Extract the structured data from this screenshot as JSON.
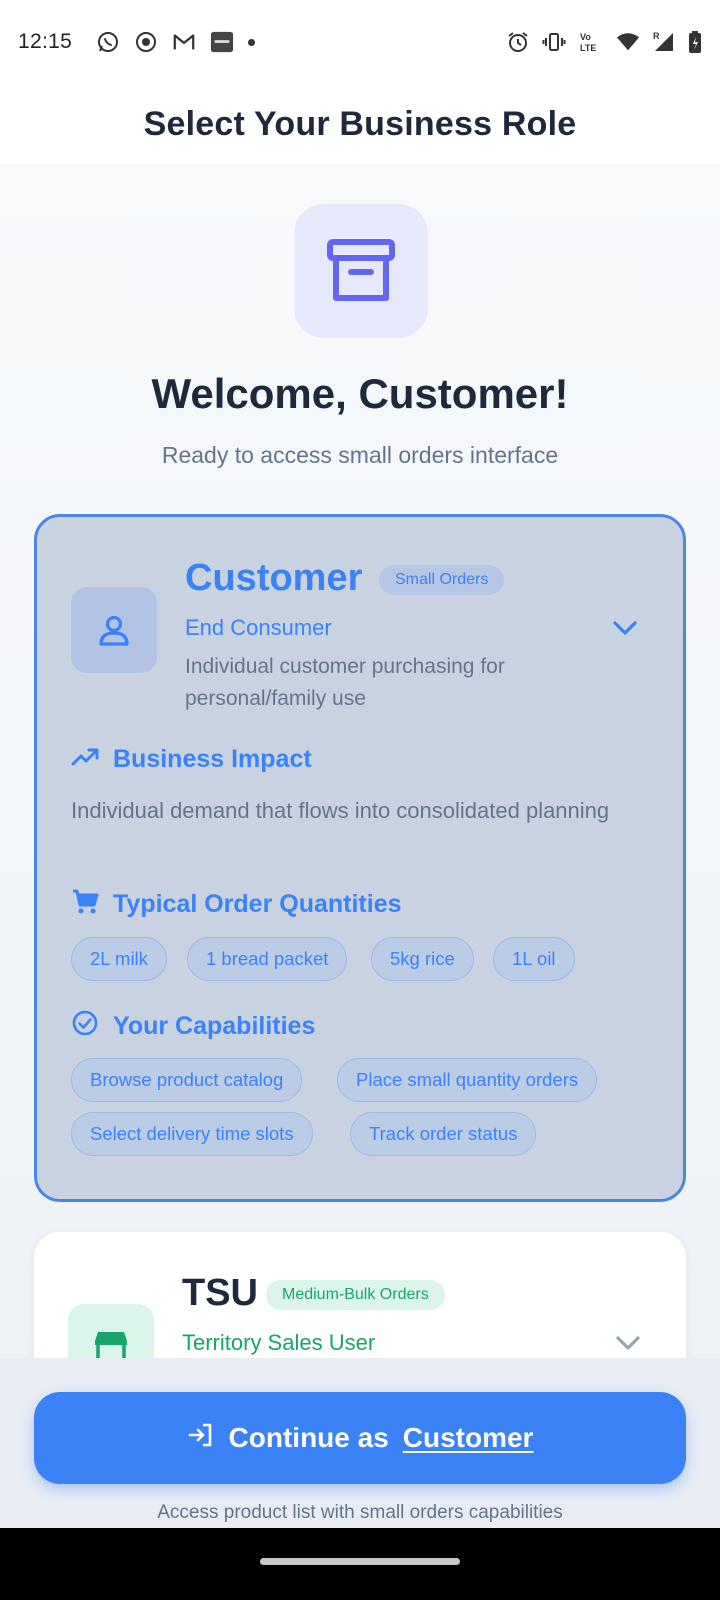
{
  "status_bar": {
    "time": "12:15",
    "left_icons": [
      "whatsapp-icon",
      "record-icon",
      "gmail-icon",
      "paytm-icon",
      "dot-icon"
    ],
    "right_icons": [
      "alarm-icon",
      "vibrate-icon",
      "volte-icon",
      "wifi-icon",
      "signal-icon",
      "battery-icon"
    ],
    "network_label": "Vo LTE",
    "roaming_label": "R"
  },
  "header": {
    "title": "Select Your Business Role"
  },
  "hero": {
    "icon": "archive-box-icon",
    "welcome": "Welcome, Customer!",
    "subtitle": "Ready to access small orders interface"
  },
  "customer_card": {
    "icon": "user-icon",
    "title": "Customer",
    "badge": "Small Orders",
    "subtitle": "End Consumer",
    "description": "Individual customer purchasing for personal/family use",
    "business_impact": {
      "heading": "Business Impact",
      "icon": "trending-up-icon",
      "text": "Individual demand that flows into consolidated planning"
    },
    "typical_quantities": {
      "heading": "Typical Order Quantities",
      "icon": "cart-icon",
      "items": [
        "2L milk",
        "1 bread packet",
        "5kg rice",
        "1L oil"
      ]
    },
    "capabilities": {
      "heading": "Your Capabilities",
      "icon": "check-circle-icon",
      "items": [
        "Browse product catalog",
        "Place small quantity orders",
        "Select delivery time slots",
        "Track order status"
      ]
    },
    "selected": true,
    "accent_color": "#3b82f6"
  },
  "tsu_card": {
    "icon": "store-icon",
    "title": "TSU",
    "badge": "Medium-Bulk Orders",
    "subtitle": "Territory Sales User",
    "accent_color": "#16a56a"
  },
  "footer": {
    "button_prefix": "Continue as",
    "button_role": "Customer",
    "button_icon": "login-icon",
    "note": "Access product list with small orders capabilities"
  }
}
